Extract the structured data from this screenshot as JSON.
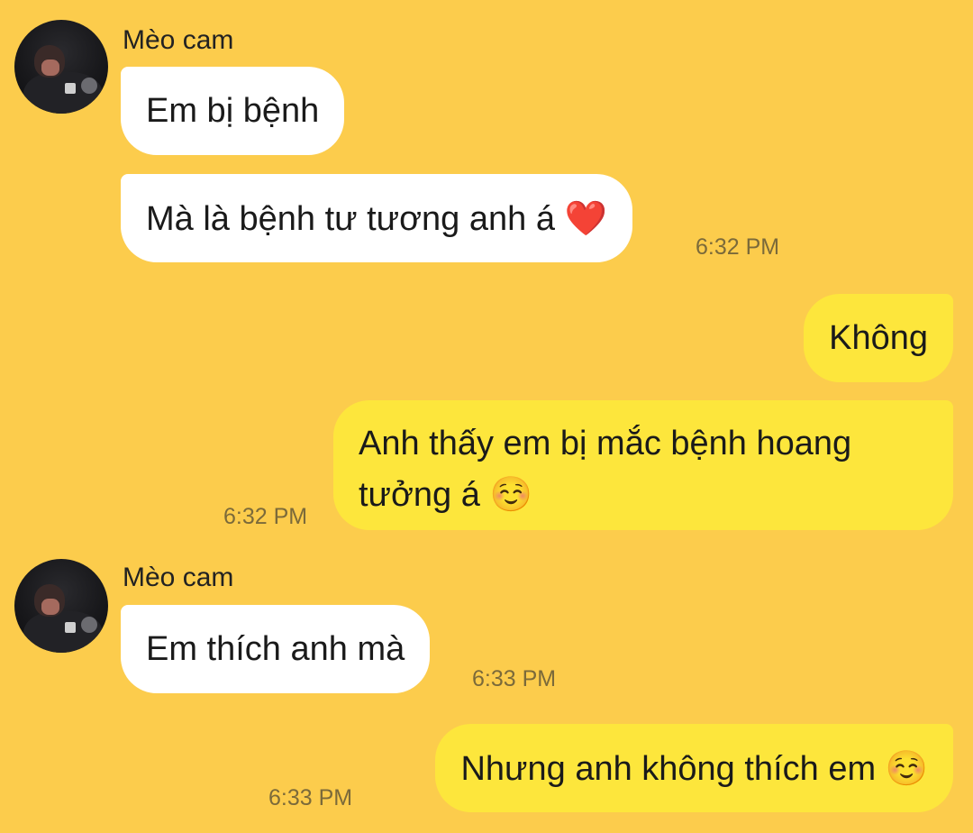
{
  "chat": {
    "sender_name": "Mèo cam",
    "blocks": [
      {
        "sender": "Mèo cam",
        "messages": [
          {
            "text": "Em bị bệnh"
          },
          {
            "text": "Mà là bệnh tư tương anh á",
            "emoji": "❤️",
            "time": "6:32 PM"
          }
        ]
      },
      {
        "sender": "me",
        "messages": [
          {
            "text": "Không"
          },
          {
            "text": "Anh thấy em bị mắc bệnh hoang tưởng á",
            "emoji": "☺️",
            "time": "6:32 PM"
          }
        ]
      },
      {
        "sender": "Mèo cam",
        "messages": [
          {
            "text": "Em thích anh mà",
            "time": "6:33 PM"
          }
        ]
      },
      {
        "sender": "me",
        "messages": [
          {
            "text": "Nhưng anh không thích em",
            "emoji": "☺️",
            "time": "6:33 PM"
          }
        ]
      }
    ]
  },
  "colors": {
    "background": "#fccc4c",
    "incoming_bubble": "#ffffff",
    "outgoing_bubble": "#fde63c",
    "timestamp": "#7b6a3a",
    "text": "#1a1a1a"
  }
}
